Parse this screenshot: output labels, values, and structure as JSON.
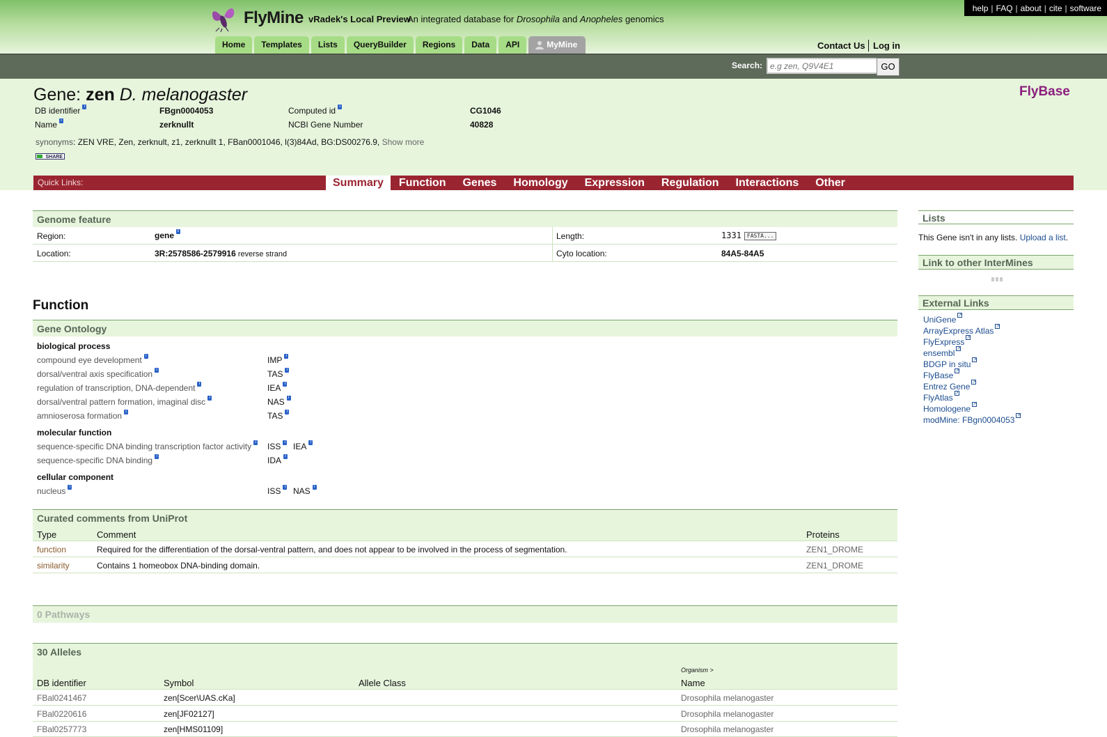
{
  "header": {
    "logo_text": "FlyMine",
    "mine_name": "vRadek's Local Preview",
    "desc_prefix": "An integrated database for ",
    "desc_genus1": "Drosophila",
    "desc_and": " and ",
    "desc_genus2": "Anopheles",
    "desc_suffix": " genomics",
    "top_links": [
      "help",
      "FAQ",
      "about",
      "cite",
      "software"
    ],
    "tabs": [
      "Home",
      "Templates",
      "Lists",
      "QueryBuilder",
      "Regions",
      "Data",
      "API",
      "MyMine"
    ],
    "contact": "Contact Us",
    "login": "Log in"
  },
  "search": {
    "label": "Search:",
    "placeholder": "e.g zen, Q9V4E1",
    "go_label": "GO"
  },
  "gene": {
    "title_prefix": "Gene: ",
    "symbol": "zen",
    "organism": "D. melanogaster",
    "source": "FlyBase",
    "fields": {
      "db_identifier_label": "DB identifier",
      "db_identifier": "FBgn0004053",
      "computed_id_label": "Computed id",
      "computed_id": "CG1046",
      "name_label": "Name",
      "name": "zerknullt",
      "ncbi_label": "NCBI Gene Number",
      "ncbi": "40828"
    },
    "synonyms_label": "synonyms",
    "synonyms": ": ZEN VRE, Zen, zerknult, z1, zerknullt 1, FBan0001046, l(3)84Ad, BG:DS00276.9,",
    "show_more": "Show more",
    "share": "SHARE"
  },
  "quick_links": {
    "label": "Quick Links:",
    "items": [
      "Summary",
      "Function",
      "Genes",
      "Homology",
      "Expression",
      "Regulation",
      "Interactions",
      "Other"
    ]
  },
  "genome_feature": {
    "title": "Genome feature",
    "region_label": "Region:",
    "region": "gene",
    "length_label": "Length:",
    "length": "1331",
    "fasta": "FASTA...",
    "location_label": "Location:",
    "location": "3R:2578586-2579916",
    "strand": " reverse strand",
    "cyto_label": "Cyto location:",
    "cyto": "84A5-84A5"
  },
  "function": {
    "title": "Function",
    "go_title": "Gene Ontology",
    "categories": [
      {
        "name": "biological process",
        "terms": [
          {
            "term": "compound eye development",
            "ev": [
              "IMP"
            ]
          },
          {
            "term": "dorsal/ventral axis specification",
            "ev": [
              "TAS"
            ]
          },
          {
            "term": "regulation of transcription, DNA-dependent",
            "ev": [
              "IEA"
            ]
          },
          {
            "term": "dorsal/ventral pattern formation, imaginal disc",
            "ev": [
              "NAS"
            ]
          },
          {
            "term": "amnioserosa formation",
            "ev": [
              "TAS"
            ]
          }
        ]
      },
      {
        "name": "molecular function",
        "terms": [
          {
            "term": "sequence-specific DNA binding transcription factor activity",
            "ev": [
              "ISS",
              "IEA"
            ]
          },
          {
            "term": "sequence-specific DNA binding",
            "ev": [
              "IDA"
            ]
          }
        ]
      },
      {
        "name": "cellular component",
        "terms": [
          {
            "term": "nucleus",
            "ev": [
              "ISS",
              "NAS"
            ]
          }
        ]
      }
    ]
  },
  "comments": {
    "title": "Curated comments from UniProt",
    "headers": [
      "Type",
      "Comment",
      "Proteins"
    ],
    "rows": [
      {
        "type": "function",
        "comment": "Required for the differentiation of the dorsal-ventral pattern, and does not appear to be involved in the process of segmentation.",
        "protein": "ZEN1_DROME"
      },
      {
        "type": "similarity",
        "comment": "Contains 1 homeobox DNA-binding domain.",
        "protein": "ZEN1_DROME"
      }
    ]
  },
  "pathways": {
    "title": "0 Pathways"
  },
  "alleles": {
    "title": "30 Alleles",
    "headers": [
      "DB identifier",
      "Symbol",
      "Allele Class",
      "Name"
    ],
    "organism_small": "Organism  >",
    "rows": [
      {
        "id": "FBal0241467",
        "symbol": "zen[Scer\\UAS.cKa]",
        "org": "Drosophila melanogaster"
      },
      {
        "id": "FBal0220616",
        "symbol": "zen[JF02127]",
        "org": "Drosophila melanogaster"
      },
      {
        "id": "FBal0257773",
        "symbol": "zen[HMS01109]",
        "org": "Drosophila melanogaster"
      }
    ]
  },
  "sidebar": {
    "lists_title": "Lists",
    "lists_text": "This Gene isn't in any lists. ",
    "lists_link": "Upload a list",
    "lists_end": ".",
    "intermine_title": "Link to other InterMines",
    "external_title": "External Links",
    "external_links": [
      "UniGene",
      "ArrayExpress Atlas",
      "FlyExpress",
      "ensembl",
      "BDGP in situ",
      "FlyBase",
      "Entrez Gene",
      "FlyAtlas",
      "Homologene",
      "modMine: FBgn0004053"
    ]
  }
}
